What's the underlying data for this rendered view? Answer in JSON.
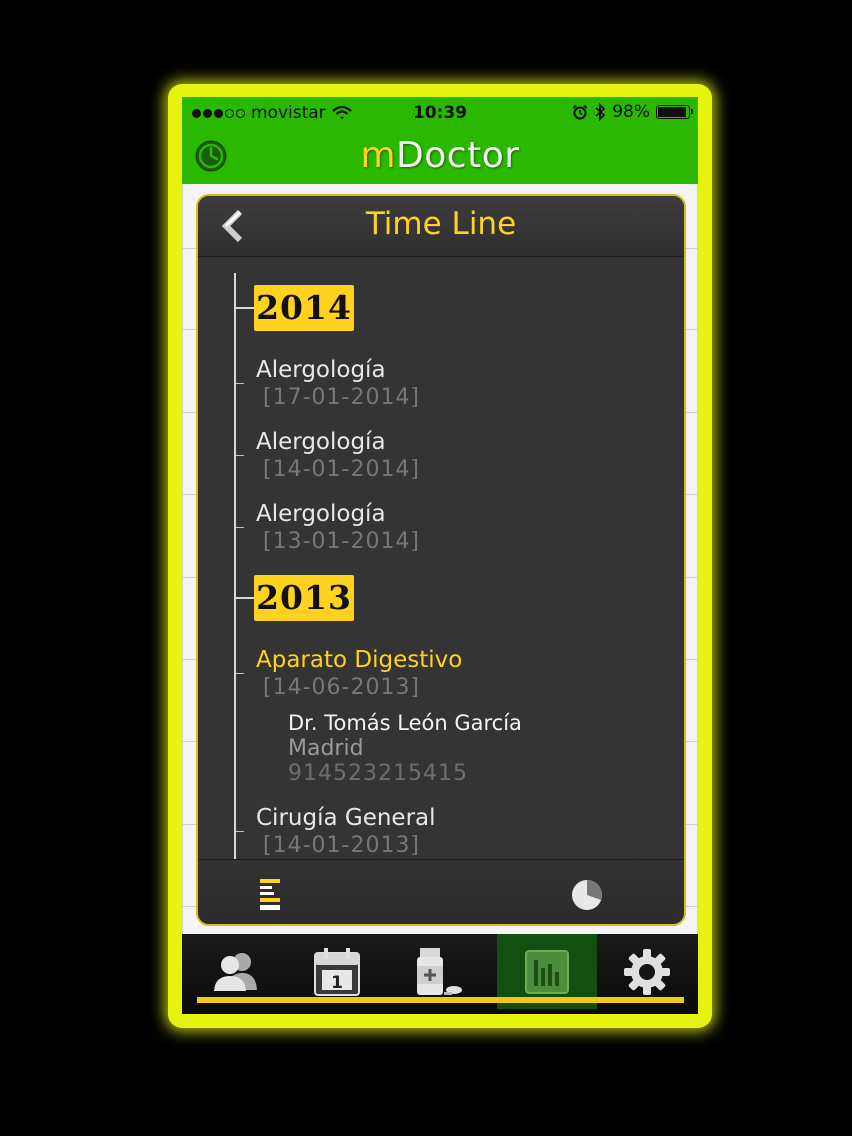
{
  "status_bar": {
    "carrier": "movistar",
    "time": "10:39",
    "battery": "98%",
    "battery_level": 0.98
  },
  "header": {
    "app_title_first": "m",
    "app_title_rest": "Doctor",
    "clock_icon": "clock-icon"
  },
  "panel": {
    "title": "Time Line",
    "back_icon": "chevron-left-icon"
  },
  "timeline": {
    "years": [
      {
        "year": "2014",
        "entries": [
          {
            "title": "Alergología",
            "date": "[17-01-2014]"
          },
          {
            "title": "Alergología",
            "date": "[14-01-2014]"
          },
          {
            "title": "Alergología",
            "date": "[13-01-2014]"
          }
        ]
      },
      {
        "year": "2013",
        "entries": [
          {
            "title": "Aparato Digestivo",
            "date": "[14-06-2013]",
            "expanded": true,
            "doctor": "Dr. Tomás León García",
            "city": "Madrid",
            "phone": "914523215415"
          },
          {
            "title": "Cirugía General",
            "date": "[14-01-2013]"
          }
        ]
      }
    ]
  },
  "footer": {
    "list_icon": "list-icon",
    "pie_icon": "pie-chart-icon"
  },
  "tabbar": {
    "tabs": [
      {
        "icon": "users-icon"
      },
      {
        "icon": "calendar-icon",
        "badge": "1"
      },
      {
        "icon": "medicine-icon"
      },
      {
        "icon": "bar-chart-icon",
        "active": true
      },
      {
        "icon": "gear-icon"
      }
    ]
  },
  "colors": {
    "accent_yellow": "#ffd21f",
    "header_green": "#2ab800",
    "frame_yellow": "#e4f40c"
  }
}
